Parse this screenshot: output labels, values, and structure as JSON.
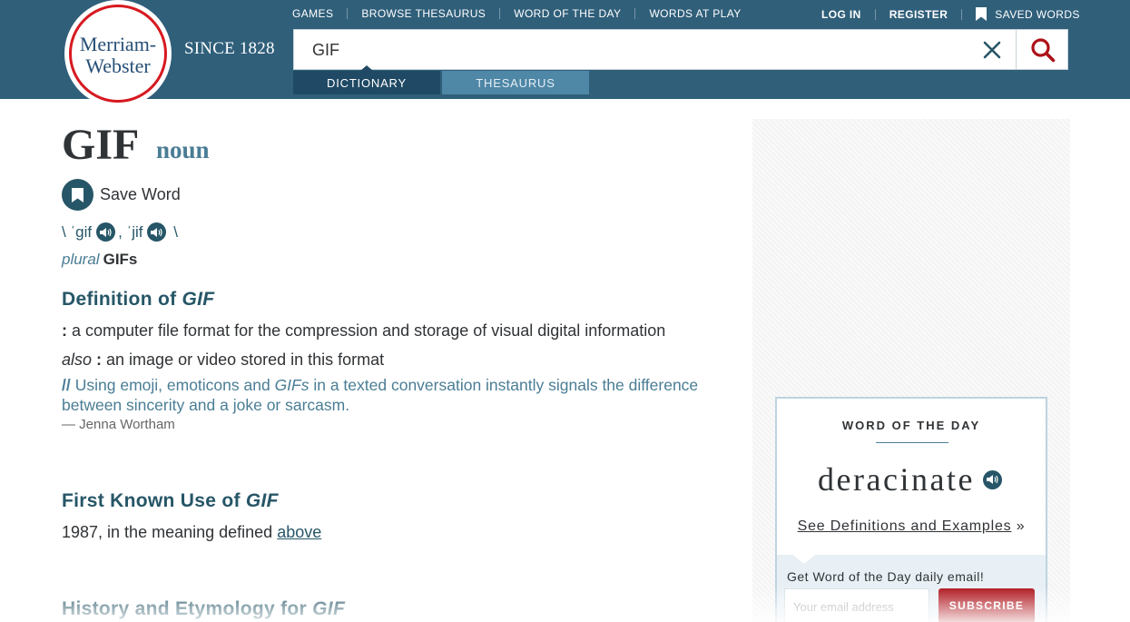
{
  "brand": {
    "logo_line1": "Merriam-",
    "logo_line2": "Webster",
    "since": "SINCE 1828",
    "red": "#d71920",
    "navy": "#305f7a"
  },
  "nav": {
    "left": [
      "GAMES",
      "BROWSE THESAURUS",
      "WORD OF THE DAY",
      "WORDS AT PLAY"
    ],
    "login": "LOG IN",
    "register": "REGISTER",
    "saved_words": "SAVED WORDS"
  },
  "search": {
    "value": "GIF",
    "clear_icon": "close-icon",
    "search_icon": "magnifier-icon"
  },
  "tabs": {
    "dictionary": "DICTIONARY",
    "thesaurus": "THESAURUS",
    "active": "DICTIONARY"
  },
  "entry": {
    "headword": "GIF",
    "part_of_speech": "noun",
    "save_word": "Save Word",
    "pron_open": "\\ ",
    "pron1": "ˈgif",
    "pron_comma": ", ",
    "pron2": "ˈjif",
    "pron_close": " \\",
    "plural_label": "plural",
    "plural_form": "GIFs",
    "definition": {
      "title_prefix": "Definition of ",
      "title_word": "GIF",
      "sense1": "a computer file format for the compression and storage of visual digital information",
      "also_label": "also",
      "sense2": "an image or video stored in this format",
      "example_slashes": "//",
      "example_a": "Using emoji, emoticons and ",
      "example_em": "GIFs",
      "example_b": " in a texted conversation instantly signals the difference between sincerity and a joke or sarcasm.",
      "credit": "— Jenna Wortham"
    },
    "first_known_use": {
      "title_prefix": "First Known Use of ",
      "title_word": "GIF",
      "text": "1987, in the meaning defined ",
      "link": "above"
    },
    "history": {
      "title_prefix": "History and Etymology for ",
      "title_word": "GIF"
    }
  },
  "wotd": {
    "label": "WORD OF THE DAY",
    "word": "deracinate",
    "link": "See Definitions and Examples",
    "link_suffix": " »",
    "email_label": "Get Word of the Day daily email!",
    "email_placeholder": "Your email address",
    "subscribe": "SUBSCRIBE"
  }
}
